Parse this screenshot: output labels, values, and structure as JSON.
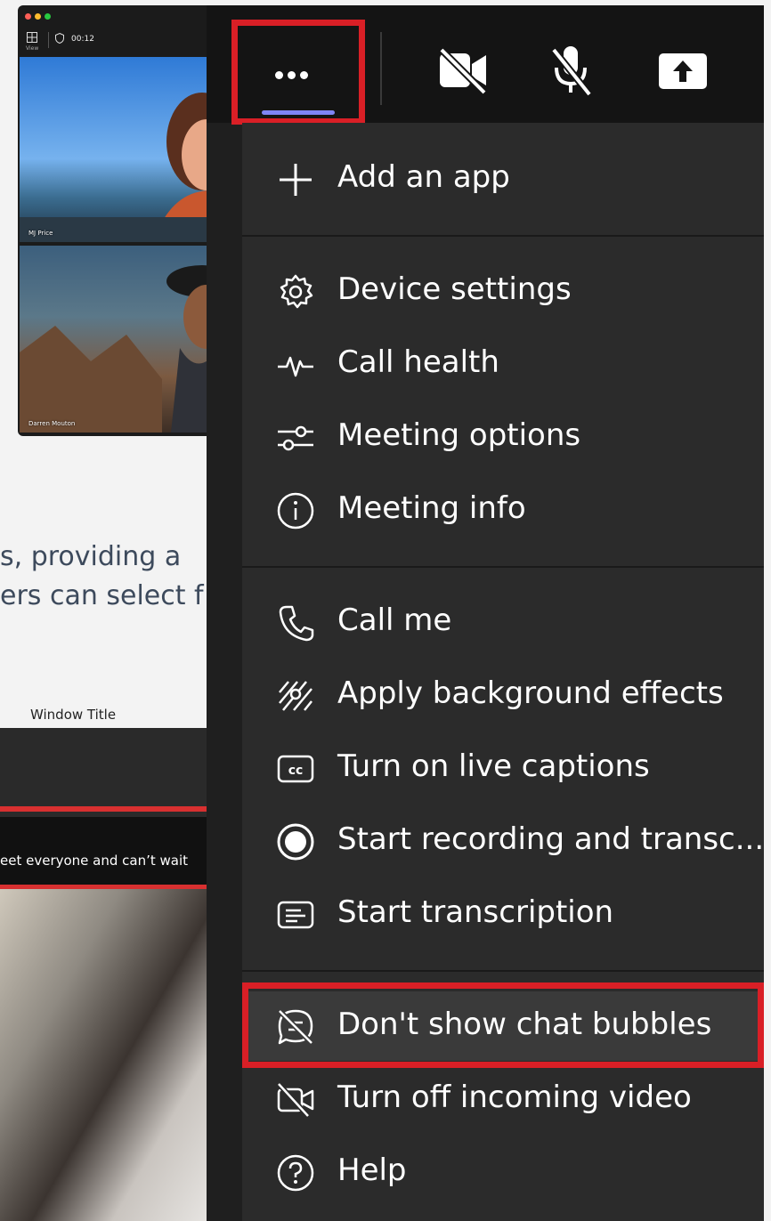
{
  "background": {
    "timer": "00:12",
    "view_label": "View",
    "participant_1": "MJ Price",
    "participant_2": "Darren Mouton",
    "text_line_1": "s, providing a",
    "text_line_2": "ers can select f",
    "window_title": "Window Title",
    "caption": "eet everyone and can’t wait"
  },
  "toolbar": {
    "more_icon": "more-horizontal-icon",
    "camera_icon": "camera-off-icon",
    "mic_icon": "microphone-off-icon",
    "share_icon": "share-screen-icon",
    "accent_color": "#7f85f5",
    "highlight_color": "#d91f26"
  },
  "menu": {
    "items": [
      {
        "label": "Add an app",
        "icon": "plus-icon"
      },
      {
        "label": "Device settings",
        "icon": "gear-icon"
      },
      {
        "label": "Call health",
        "icon": "pulse-icon"
      },
      {
        "label": "Meeting options",
        "icon": "sliders-icon"
      },
      {
        "label": "Meeting info",
        "icon": "info-icon"
      },
      {
        "label": "Call me",
        "icon": "phone-icon"
      },
      {
        "label": "Apply background effects",
        "icon": "background-effects-icon"
      },
      {
        "label": "Turn on live captions",
        "icon": "closed-captions-icon"
      },
      {
        "label": "Start recording and transc...",
        "icon": "record-icon"
      },
      {
        "label": "Start transcription",
        "icon": "transcript-icon"
      },
      {
        "label": "Don't show chat bubbles",
        "icon": "chat-off-icon"
      },
      {
        "label": "Turn off incoming video",
        "icon": "video-off-icon"
      },
      {
        "label": "Help",
        "icon": "help-icon"
      }
    ]
  }
}
